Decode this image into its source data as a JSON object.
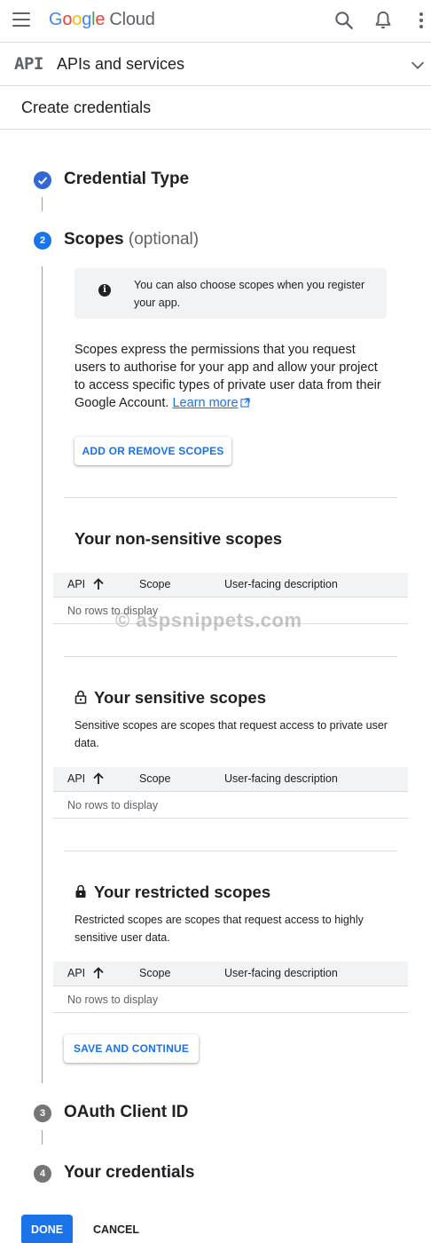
{
  "topbar": {
    "logo_g": "G",
    "logo_o1": "o",
    "logo_o2": "o",
    "logo_g2": "g",
    "logo_l": "l",
    "logo_e": "e",
    "logo_cloud": "Cloud"
  },
  "product": {
    "badge": "API",
    "title": "APIs and services"
  },
  "page": {
    "title": "Create credentials"
  },
  "steps": [
    {
      "number": "",
      "title": "Credential Type",
      "state": "done"
    },
    {
      "number": "2",
      "title": "Scopes",
      "suffix": "(optional)",
      "state": "active"
    },
    {
      "number": "3",
      "title": "OAuth Client ID",
      "state": "pending"
    },
    {
      "number": "4",
      "title": "Your credentials",
      "state": "pending"
    }
  ],
  "scopes": {
    "info_icon": "i",
    "info_text": "You can also choose scopes when you register your app.",
    "description": "Scopes express the permissions that you request users to authorise for your app and allow your project to access specific types of private user data from their Google Account.",
    "learn_more": "Learn more",
    "add_button": "ADD OR REMOVE SCOPES",
    "non_sensitive": {
      "title": "Your non-sensitive scopes"
    },
    "sensitive": {
      "title": "Your sensitive scopes",
      "description": "Sensitive scopes are scopes that request access to private user data."
    },
    "restricted": {
      "title": "Your restricted scopes",
      "description": "Restricted scopes are scopes that request access to highly sensitive user data."
    },
    "columns": {
      "api": "API",
      "scope": "Scope",
      "description": "User-facing description"
    },
    "empty": "No rows to display",
    "save_button": "SAVE AND CONTINUE"
  },
  "watermark": "© aspsnippets.com",
  "actions": {
    "done": "DONE",
    "cancel": "CANCEL"
  },
  "colors": {
    "accent": "#1a73e8",
    "step_done": "#3367d6",
    "step_pending": "#757575"
  },
  "icons": [
    "menu-icon",
    "search-icon",
    "bell-icon",
    "more-vert-icon",
    "chevron-down-icon",
    "check-icon",
    "info-icon",
    "external-link-icon",
    "lock-open-icon",
    "lock-icon",
    "arrow-up-icon"
  ]
}
